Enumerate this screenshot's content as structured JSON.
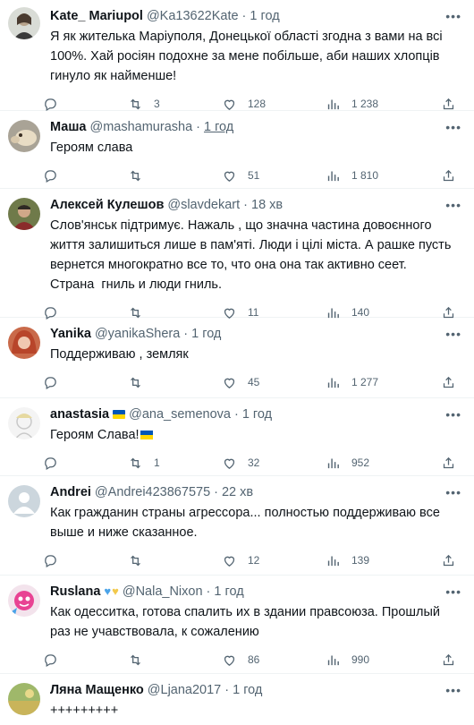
{
  "tweets": [
    {
      "name": "Kate_ Mariupol",
      "handle": "@Ka13622Kate",
      "time": "1 год",
      "text": "Я як жителька Маріуполя, Донецької області згодна з вами на всі 100%. Хай росіян подохне за мене побільше, аби наших хлопців гинуло як найменше!",
      "replies": "",
      "retweets": "3",
      "likes": "128",
      "views": "1 238",
      "avatar": "avatar-woman-photo"
    },
    {
      "name": "Маша",
      "handle": "@mashamurasha",
      "time": "1 год",
      "text": "Героям слава",
      "replies": "",
      "retweets": "",
      "likes": "51",
      "views": "1 810",
      "avatar": "avatar-animal-photo"
    },
    {
      "name": "Алексей Кулешов",
      "handle": "@slavdekart",
      "time": "18 хв",
      "text": "Слов'янськ підтримує. Нажаль , що значна частина довоєнного життя залишиться лише в пам'яті. Люди і цілі міста. А рашке пусть вернется многократно все то, что она она так активно сеет.  Страна  гниль и люди гниль.",
      "replies": "",
      "retweets": "",
      "likes": "11",
      "views": "140",
      "avatar": "avatar-man-photo"
    },
    {
      "name": "Yanika",
      "handle": "@yanikaShera",
      "time": "1 год",
      "text": "Поддерживаю , земляк",
      "replies": "",
      "retweets": "",
      "likes": "45",
      "views": "1 277",
      "avatar": "avatar-redhead-photo"
    },
    {
      "name": "anastasia",
      "handle": "@ana_semenova",
      "time": "1 год",
      "text": "Героям Слава!",
      "replies": "",
      "retweets": "1",
      "likes": "32",
      "views": "952",
      "avatar": "avatar-drawing"
    },
    {
      "name": "Andrei",
      "handle": "@Andrei423867575",
      "time": "22 хв",
      "text": "Как гражданин страны агрессора... полностью поддерживаю все выше и ниже сказанное.",
      "replies": "",
      "retweets": "",
      "likes": "12",
      "views": "139",
      "avatar": "avatar-default"
    },
    {
      "name": "Ruslana",
      "handle": "@Nala_Nixon",
      "time": "1 год",
      "text": "Как одесситка, готова спалить их в здании правсоюза. Прошлый раз не учавствовала, к сожалению",
      "replies": "",
      "retweets": "",
      "likes": "86",
      "views": "990",
      "avatar": "avatar-cartoon"
    },
    {
      "name": "Ляна Мащенко",
      "handle": "@Ljana2017",
      "time": "1 год",
      "text": "+++++++++",
      "replies": "",
      "retweets": "",
      "likes": "",
      "views": "",
      "avatar": "avatar-landscape-photo"
    }
  ],
  "icons": {
    "reply": "reply-icon",
    "retweet": "retweet-icon",
    "like": "like-icon",
    "views": "views-icon",
    "share": "share-icon",
    "more": "more-icon"
  },
  "colors": {
    "text": "#0f1419",
    "muted": "#536471",
    "divider": "#eff3f4",
    "flag_blue": "#0057b7",
    "flag_yellow": "#ffd700"
  }
}
